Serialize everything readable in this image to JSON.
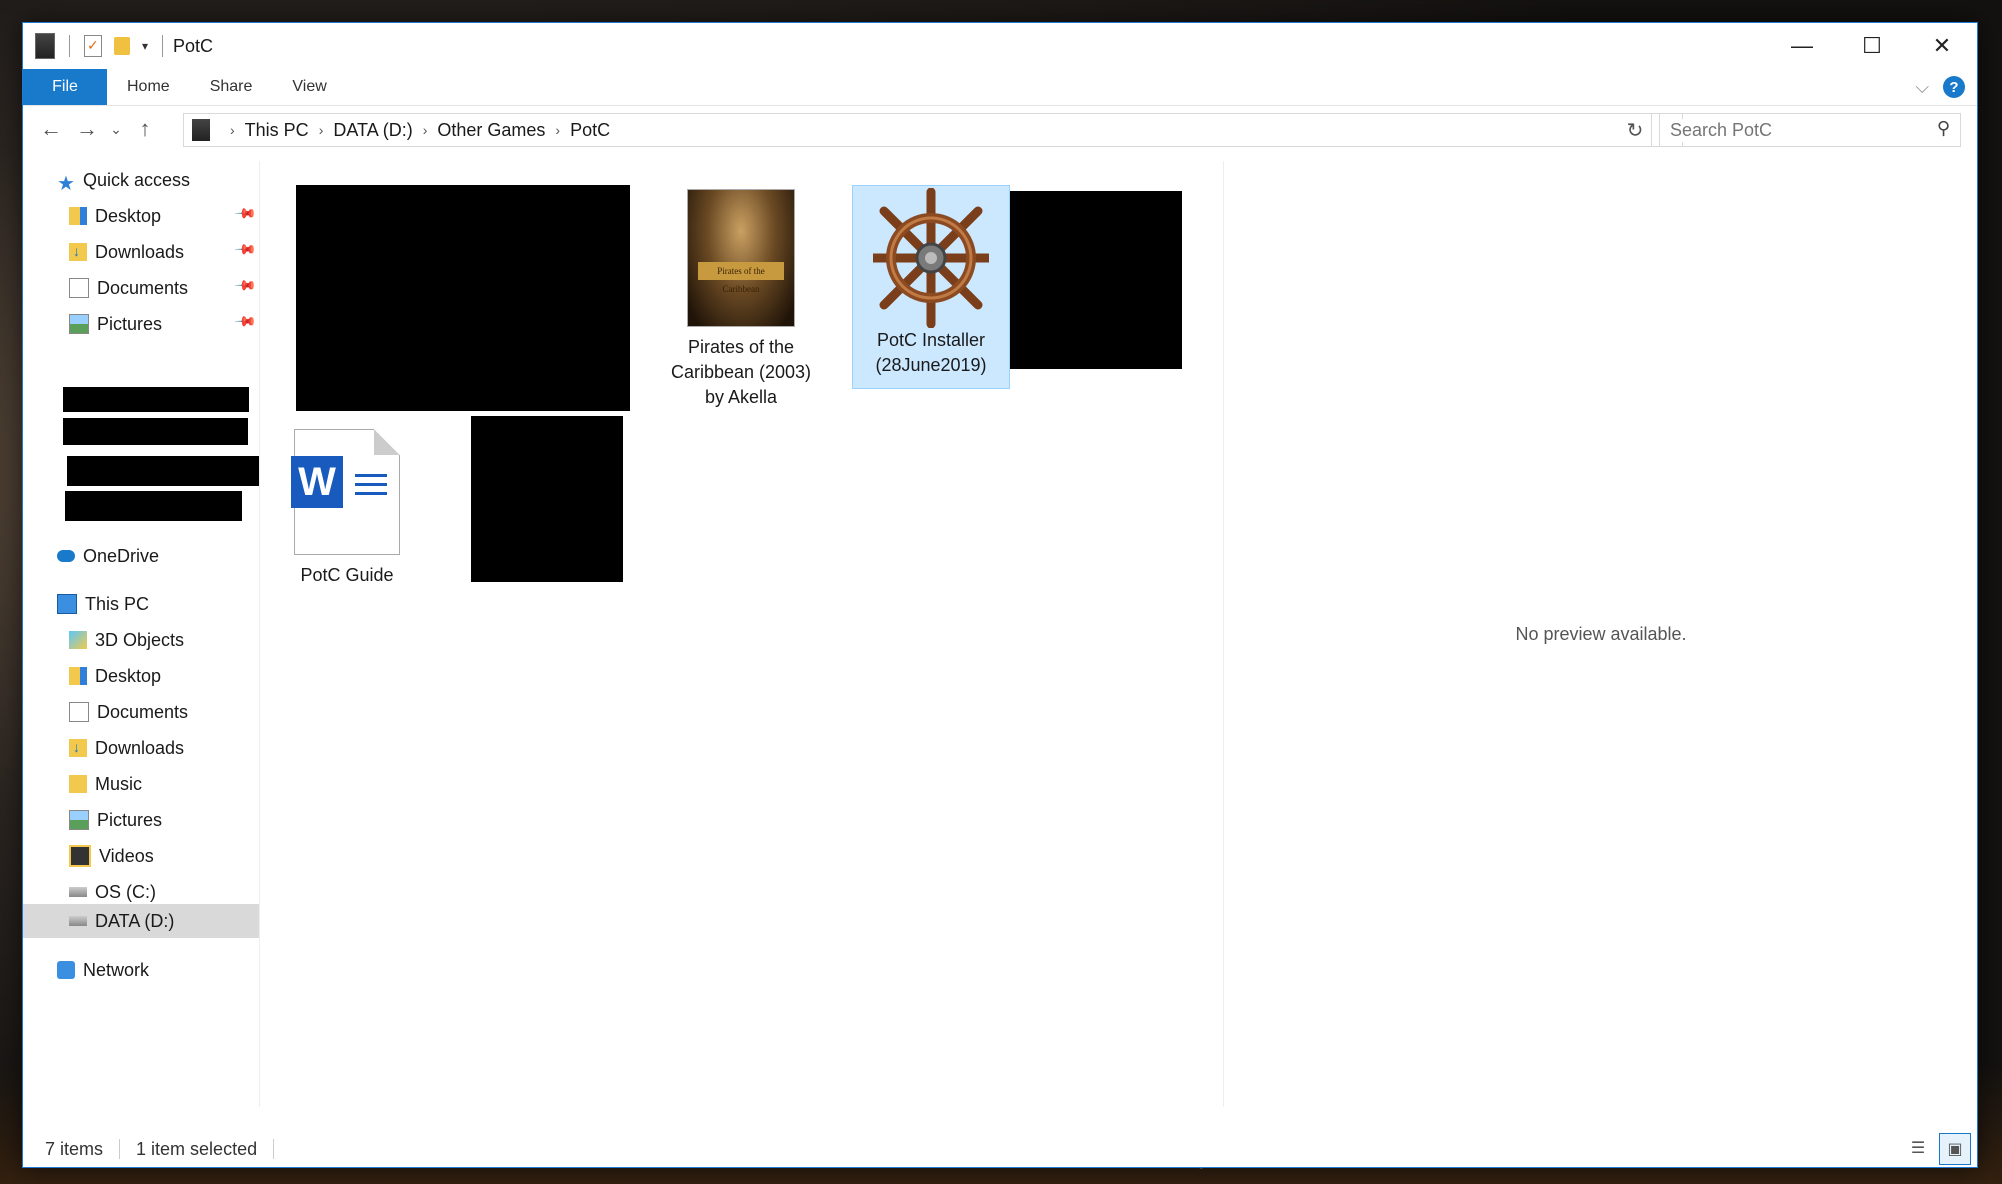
{
  "window": {
    "title": "PotC"
  },
  "ribbon": {
    "tabs": [
      "File",
      "Home",
      "Share",
      "View"
    ]
  },
  "address": {
    "crumbs": [
      "This PC",
      "DATA (D:)",
      "Other Games",
      "PotC"
    ]
  },
  "search": {
    "placeholder": "Search PotC"
  },
  "sidebar": {
    "quick_access": "Quick access",
    "quick_items": [
      "Desktop",
      "Downloads",
      "Documents",
      "Pictures"
    ],
    "onedrive": "OneDrive",
    "this_pc": "This PC",
    "pc_items": [
      "3D Objects",
      "Desktop",
      "Documents",
      "Downloads",
      "Music",
      "Pictures",
      "Videos",
      "OS (C:)",
      "DATA (D:)"
    ],
    "network": "Network",
    "selected": "DATA (D:)"
  },
  "files": [
    {
      "label_lines": [
        "Pirates of the",
        "Caribbean (2003)",
        "by Akella"
      ],
      "kind": "cover",
      "selected": false
    },
    {
      "label_lines": [
        "PotC Installer",
        "(28June2019)"
      ],
      "kind": "wheel",
      "selected": true
    },
    {
      "label_lines": [
        "PotC Guide"
      ],
      "kind": "word",
      "selected": false
    }
  ],
  "cover_band_text": "Pirates of the Caribbean",
  "preview": {
    "message": "No preview available."
  },
  "status": {
    "count": "7 items",
    "selection": "1 item selected"
  },
  "icons": {
    "back": "arrow-left-icon",
    "forward": "arrow-right-icon",
    "up": "arrow-up-icon",
    "refresh": "refresh-icon",
    "search": "search-icon",
    "help": "help-icon"
  },
  "colors": {
    "accent": "#1979ca",
    "selection": "#cce8ff",
    "word": "#185abd"
  }
}
